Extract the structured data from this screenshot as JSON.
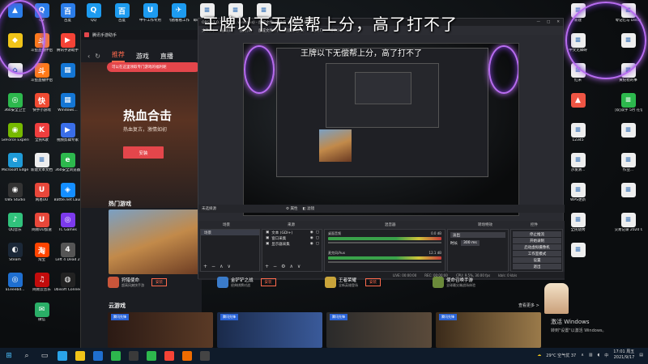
{
  "overlay": {
    "caption": "王牌以下无偿帮上分，高了打不了"
  },
  "desktop": {
    "left_icons": [
      {
        "label": "",
        "color": "#2b7de9",
        "glyph": "▲",
        "icon": "folder-icon"
      },
      {
        "label": "",
        "color": "#f0c419",
        "glyph": "◆",
        "icon": "app-icon"
      },
      {
        "label": "",
        "color": "#eee",
        "glyph": "⌂",
        "icon": "recycle-icon"
      },
      {
        "label": "360安全卫士",
        "color": "#2db84d",
        "glyph": "◎",
        "icon": "shield-icon"
      },
      {
        "label": "GeForce Experience",
        "color": "#76b900",
        "glyph": "◉",
        "icon": "nvidia-icon"
      },
      {
        "label": "Microsoft Edge",
        "color": "#1f9bd7",
        "glyph": "e",
        "icon": "edge-icon"
      },
      {
        "label": "OBS Studio",
        "color": "#333",
        "glyph": "◉",
        "icon": "obs-icon"
      },
      {
        "label": "QQ音乐",
        "color": "#31c27c",
        "glyph": "♪",
        "icon": "music-icon"
      },
      {
        "label": "Steam",
        "color": "#1b2838",
        "glyph": "◐",
        "icon": "steam-icon"
      },
      {
        "label": "a1eeebd...",
        "color": "#1f6fd0",
        "glyph": "◎",
        "icon": "app-icon"
      }
    ],
    "col2_icons": [
      {
        "label": "Q2",
        "color": "#2b7de9",
        "glyph": "Q",
        "icon": "app-icon"
      },
      {
        "label": "斗鱼直播伴侣",
        "color": "#ff7a1a",
        "glyph": "斗",
        "icon": "douyu-icon"
      },
      {
        "label": "斗鱼直播伴侣",
        "color": "#ff7a1a",
        "glyph": "斗",
        "icon": "douyu-icon"
      },
      {
        "label": "快手小游戏",
        "color": "#f04b32",
        "glyph": "快",
        "icon": "app-icon"
      },
      {
        "label": "全民K歌",
        "color": "#ef3e3e",
        "glyph": "K",
        "icon": "app-icon"
      },
      {
        "label": "新建文本文档",
        "color": "#eee",
        "glyph": "≡",
        "icon": "text-file-icon"
      },
      {
        "label": "网易UU",
        "color": "#e8473a",
        "glyph": "U",
        "icon": "app-icon"
      },
      {
        "label": "网易UU加速",
        "color": "#e8473a",
        "glyph": "U",
        "icon": "app-icon"
      },
      {
        "label": "淘宝",
        "color": "#ff4400",
        "glyph": "淘",
        "icon": "app-icon"
      },
      {
        "label": "网易云音乐",
        "color": "#c20c0c",
        "glyph": "♫",
        "icon": "music-icon"
      },
      {
        "label": "微信",
        "color": "#2aae67",
        "glyph": "✉",
        "icon": "wechat-icon"
      }
    ],
    "col3_icons": [
      {
        "label": "百度",
        "color": "#2b7de9",
        "glyph": "百",
        "icon": "app-icon"
      },
      {
        "label": "腾讯手游助手",
        "color": "#f44336",
        "glyph": "▶",
        "icon": "app-icon"
      },
      {
        "label": "",
        "color": "#1476d4",
        "glyph": "▦",
        "icon": "windows-icon"
      },
      {
        "label": "Windows...",
        "color": "#1476d4",
        "glyph": "▦",
        "icon": "windows-icon"
      },
      {
        "label": "视频剪辑专家",
        "color": "#3a6ee8",
        "glyph": "▶",
        "icon": "app-icon"
      },
      {
        "label": "360安全浏览器",
        "color": "#2db84d",
        "glyph": "e",
        "icon": "browser-icon"
      },
      {
        "label": "Battle.net Launcher",
        "color": "#148eff",
        "glyph": "◈",
        "icon": "battlenet-icon"
      },
      {
        "label": "TC Games",
        "color": "#7c3aed",
        "glyph": "◎",
        "icon": "app-icon"
      },
      {
        "label": "Left 4 Dead 2",
        "color": "#555",
        "glyph": "4",
        "icon": "game-icon"
      },
      {
        "label": "Ubisoft Connect",
        "color": "#222",
        "glyph": "◍",
        "icon": "ubisoft-icon"
      }
    ],
    "top_icons": [
      {
        "label": "QQ",
        "color": "#1d9bf0",
        "glyph": "Q",
        "icon": "qq-icon"
      },
      {
        "label": "百度",
        "color": "#1d9bf0",
        "glyph": "百",
        "icon": "app-icon"
      },
      {
        "label": "中午工作专用",
        "color": "#1d9bf0",
        "glyph": "U",
        "icon": "app-icon"
      },
      {
        "label": "飞猪看看工作",
        "color": "#1d9bf0",
        "glyph": "✈",
        "icon": "app-icon"
      },
      {
        "label": "邮箱问题汇总 20210727",
        "color": "#eee",
        "glyph": "≡",
        "icon": "doc-icon"
      },
      {
        "label": "重要事件",
        "color": "#eee",
        "glyph": "≡",
        "icon": "doc-icon"
      },
      {
        "label": "重要事件2",
        "color": "#eee",
        "glyph": "≡",
        "icon": "doc-icon"
      }
    ],
    "right_icons": [
      {
        "label": "新建",
        "color": "#eee",
        "glyph": "≡",
        "icon": "doc-icon"
      },
      {
        "label": "中文无障碍",
        "color": "#eee",
        "glyph": "≡",
        "icon": "doc-icon"
      },
      {
        "label": "红米",
        "color": "#eee",
        "glyph": "≡",
        "icon": "doc-icon"
      },
      {
        "label": "",
        "color": "#e54",
        "glyph": "▲",
        "icon": "pdf-icon"
      },
      {
        "label": "12345",
        "color": "#eee",
        "glyph": "≡",
        "icon": "doc-icon"
      },
      {
        "label": "沙发清...",
        "color": "#eee",
        "glyph": "≡",
        "icon": "doc-icon"
      },
      {
        "label": "WPS更新",
        "color": "#eee",
        "glyph": "≡",
        "icon": "doc-icon"
      },
      {
        "label": "全民烧烤",
        "color": "#eee",
        "glyph": "≡",
        "icon": "doc-icon"
      },
      {
        "label": "",
        "color": "#eee",
        "glyph": "≡",
        "icon": "doc-icon"
      },
      {
        "label": "零记忆与 Delos",
        "color": "#eee",
        "glyph": "≡",
        "icon": "doc-icon"
      },
      {
        "label": "",
        "color": "#eee",
        "glyph": "≡",
        "icon": "doc-icon"
      },
      {
        "label": "黄纪稳的事",
        "color": "#eee",
        "glyph": "≡",
        "icon": "doc-icon"
      },
      {
        "label": "[双]双字 5月 在信理局版",
        "color": "#2db84d",
        "glyph": "≡",
        "icon": "xls-icon"
      },
      {
        "label": "",
        "color": "#eee",
        "glyph": "≡",
        "icon": "doc-icon"
      },
      {
        "label": "作业...",
        "color": "#eee",
        "glyph": "≡",
        "icon": "doc-icon"
      },
      {
        "label": "",
        "color": "#eee",
        "glyph": "≡",
        "icon": "doc-icon"
      },
      {
        "label": "交易记录 2020 0623",
        "color": "#eee",
        "glyph": "≡",
        "icon": "doc-icon"
      }
    ]
  },
  "game_assistant": {
    "title": "腾讯手游助手",
    "tabs": [
      "推荐",
      "游戏",
      "直播"
    ],
    "promo": "可以在这里领取专门游戏的福利呢",
    "hero_title": "热血合击",
    "hero_sub": "热血复古，激情如初",
    "install": "安装",
    "hot_section": "热门游戏",
    "cloud_section": "云游戏",
    "more": "查看更多 >",
    "games": [
      {
        "name": "狩猎使命",
        "desc": "超高风爽快手游",
        "color": "#c9553a"
      },
      {
        "name": "金铲铲之战",
        "desc": "经典棋牌对战",
        "color": "#3a7bc9"
      },
      {
        "name": "王者荣耀",
        "desc": "全新英雄登场",
        "color": "#c9a43a"
      },
      {
        "name": "使命召唤手游",
        "desc": "全球最尖端战场体验",
        "color": "#6b8a3a"
      }
    ],
    "cloud_tags": [
      "腾讯先锋",
      "腾讯先锋",
      "腾讯先锋",
      "腾讯先锋"
    ]
  },
  "obs": {
    "title": "OBS 27.0.1 (64-bit, windows) - 配置文件: 未命名 - 场景: 未命名",
    "menu": [
      "文件(F)",
      "编辑(E)",
      "视图(V)",
      "配置文件(P)",
      "场景集合(S)",
      "工具(T)",
      "帮助(H)"
    ],
    "scenes_header": "场景",
    "sources_header": "来源",
    "mixer_header": "混音器",
    "transitions_header": "转场特效",
    "controls_header": "控件",
    "nosource": "未选择源",
    "props": "属性",
    "filters": "滤镜",
    "scene_item": "场景",
    "sources": [
      "文本 (GDI+)",
      "窗口采集",
      "显示器采集"
    ],
    "mixer_channels": [
      {
        "name": "桌面音频",
        "level": "0.0 dB"
      },
      {
        "name": "麦克风/Aux",
        "level": "12.1 dB"
      }
    ],
    "transition_name": "淡出",
    "duration_label": "时长",
    "duration_value": "300 ms",
    "controls": [
      "停止推流",
      "开始录制",
      "启动虚拟摄像机",
      "工作室模式",
      "设置",
      "退出"
    ],
    "status": [
      "LIVE: 00:00:00",
      "REC: 00:00:00",
      "CPU: 9.5%, 30.00 fps",
      "kb/s: 0 kb/s"
    ]
  },
  "windows": {
    "activate_title": "激活 Windows",
    "activate_sub": "转到\"设置\"以激活 Windows。"
  },
  "taskbar": {
    "weather": "29°C 空气优 37",
    "time": "17:01 周五",
    "date": "2021/9/17",
    "lang": "中"
  }
}
